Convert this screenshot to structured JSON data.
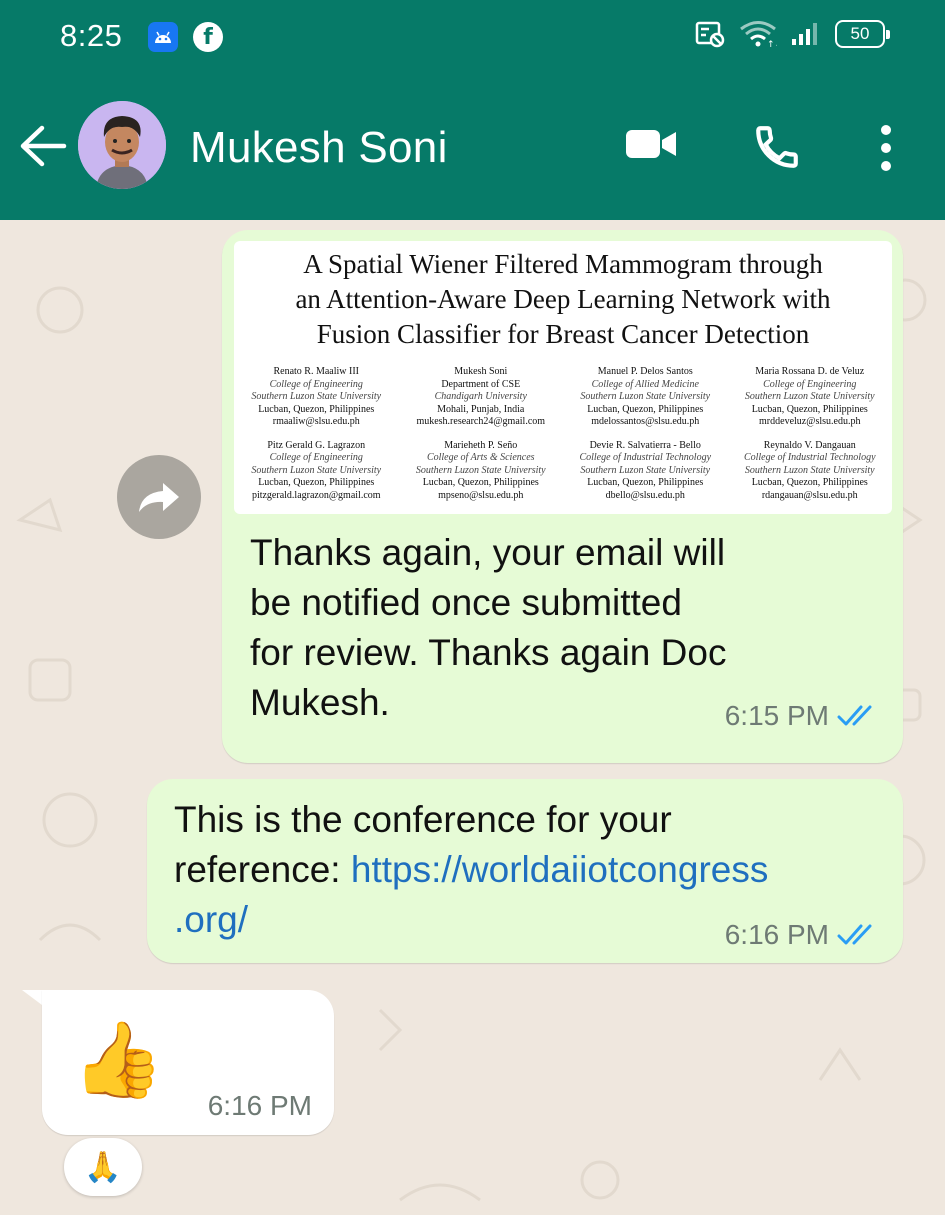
{
  "status": {
    "time": "8:25",
    "battery": "50"
  },
  "header": {
    "contact_name": "Mukesh Soni"
  },
  "messages": [
    {
      "paper": {
        "title_lines": [
          "A Spatial Wiener Filtered Mammogram through",
          "an Attention-Aware Deep Learning Network with",
          "Fusion Classifier for Breast Cancer Detection"
        ],
        "authors": [
          {
            "name": "Renato R. Maaliw III",
            "dept": "College of Engineering",
            "uni": "Southern Luzon State University",
            "loc": "Lucban, Quezon, Philippines",
            "email": "rmaaliw@slsu.edu.ph"
          },
          {
            "name": "Mukesh Soni",
            "dept": "Department of CSE",
            "uni": "Chandigarh University",
            "loc": "Mohali, Punjab, India",
            "email": "mukesh.research24@gmail.com"
          },
          {
            "name": "Manuel P. Delos Santos",
            "dept": "College of Allied Medicine",
            "uni": "Southern Luzon State University",
            "loc": "Lucban, Quezon, Philippines",
            "email": "mdelossantos@slsu.edu.ph"
          },
          {
            "name": "Maria Rossana D. de Veluz",
            "dept": "College of Engineering",
            "uni": "Southern Luzon State University",
            "loc": "Lucban, Quezon, Philippines",
            "email": "mrddeveluz@slsu.edu.ph"
          },
          {
            "name": "Pitz Gerald G. Lagrazon",
            "dept": "College of Engineering",
            "uni": "Southern Luzon State University",
            "loc": "Lucban, Quezon, Philippines",
            "email": "pitzgerald.lagrazon@gmail.com"
          },
          {
            "name": "Marieheth P. Seño",
            "dept": "College of Arts & Sciences",
            "uni": "Southern Luzon State University",
            "loc": "Lucban, Quezon, Philippines",
            "email": "mpseno@slsu.edu.ph"
          },
          {
            "name": "Devie R. Salvatierra - Bello",
            "dept": "College of Industrial Technology",
            "uni": "Southern Luzon State University",
            "loc": "Lucban, Quezon, Philippines",
            "email": "dbello@slsu.edu.ph"
          },
          {
            "name": "Reynaldo V. Dangauan",
            "dept": "College of Industrial Technology",
            "uni": "Southern Luzon State University",
            "loc": "Lucban, Quezon, Philippines",
            "email": "rdangauan@slsu.edu.ph"
          }
        ]
      },
      "text_lines": [
        "Thanks again, your email will",
        "be notified once submitted",
        "for review. Thanks again Doc",
        "Mukesh."
      ],
      "time": "6:15 PM"
    },
    {
      "text_line1": "This is the conference for your",
      "text_line2_prefix": "reference: ",
      "link_part1": "https://worldaiiotcongress",
      "link_part2": ".org/",
      "time": "6:16 PM"
    },
    {
      "emoji": "👍",
      "time": "6:16 PM",
      "reaction": "🙏"
    }
  ]
}
